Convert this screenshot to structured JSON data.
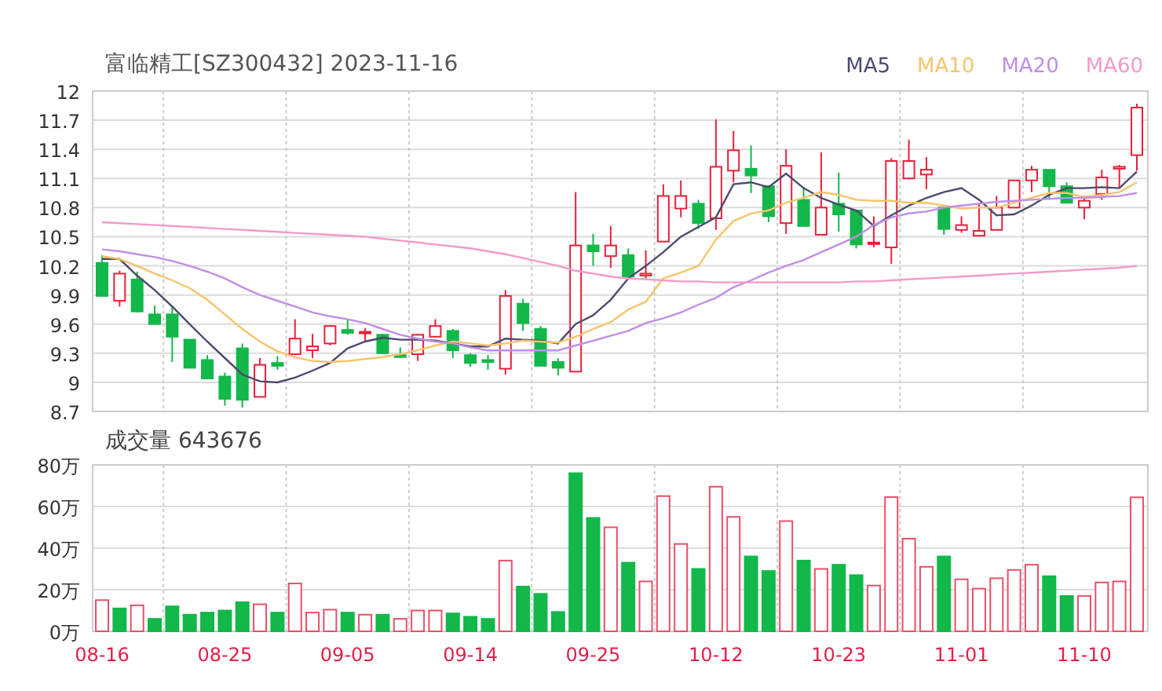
{
  "header": {
    "title": "富临精工[SZ300432] 2023-11-16"
  },
  "price_chart": {
    "chart_data": {
      "type": "candlestick",
      "grid": true,
      "ylim": [
        8.7,
        12
      ],
      "yticks": [
        12,
        11.7,
        11.4,
        11.1,
        10.8,
        10.5,
        10.2,
        9.9,
        9.6,
        9.3,
        9,
        8.7
      ],
      "categories": [
        null,
        null,
        null,
        null,
        null,
        null,
        null,
        null,
        null,
        null,
        null,
        null,
        null,
        null,
        null,
        null,
        null,
        null,
        null,
        null,
        null,
        null,
        null,
        null,
        null,
        null,
        null,
        null,
        null,
        null,
        null,
        null,
        null,
        null,
        null,
        null,
        null,
        null,
        null,
        null,
        null,
        null,
        null,
        null,
        null,
        null,
        null,
        null,
        null,
        null,
        null,
        null,
        null,
        null,
        null,
        null,
        null,
        null,
        null,
        null
      ],
      "ohlc": [
        [
          10.23,
          10.31,
          9.89,
          9.89
        ],
        [
          9.84,
          10.15,
          9.78,
          10.12
        ],
        [
          10.06,
          10.14,
          9.72,
          9.73
        ],
        [
          9.7,
          9.79,
          9.6,
          9.6
        ],
        [
          9.7,
          9.78,
          9.21,
          9.47
        ],
        [
          9.44,
          9.44,
          9.15,
          9.15
        ],
        [
          9.23,
          9.28,
          9.03,
          9.04
        ],
        [
          9.06,
          9.1,
          8.76,
          8.83
        ],
        [
          9.35,
          9.4,
          8.74,
          8.82
        ],
        [
          8.85,
          9.25,
          8.85,
          9.18
        ],
        [
          9.2,
          9.27,
          9.13,
          9.17
        ],
        [
          9.29,
          9.65,
          9.29,
          9.45
        ],
        [
          9.33,
          9.5,
          9.25,
          9.37
        ],
        [
          9.4,
          9.59,
          9.38,
          9.58
        ],
        [
          9.54,
          9.65,
          9.49,
          9.51
        ],
        [
          9.51,
          9.56,
          9.42,
          9.52
        ],
        [
          9.49,
          9.5,
          9.29,
          9.3
        ],
        [
          9.28,
          9.36,
          9.25,
          9.26
        ],
        [
          9.29,
          9.5,
          9.22,
          9.49
        ],
        [
          9.47,
          9.65,
          9.46,
          9.58
        ],
        [
          9.53,
          9.55,
          9.25,
          9.33
        ],
        [
          9.28,
          9.3,
          9.16,
          9.2
        ],
        [
          9.23,
          9.28,
          9.13,
          9.21
        ],
        [
          9.14,
          9.95,
          9.08,
          9.89
        ],
        [
          9.81,
          9.86,
          9.53,
          9.61
        ],
        [
          9.55,
          9.58,
          9.17,
          9.17
        ],
        [
          9.21,
          9.25,
          9.07,
          9.15
        ],
        [
          9.11,
          10.96,
          9.11,
          10.41
        ],
        [
          10.41,
          10.53,
          10.2,
          10.35
        ],
        [
          10.3,
          10.61,
          10.18,
          10.41
        ],
        [
          10.31,
          10.38,
          10.09,
          10.09
        ],
        [
          10.1,
          10.36,
          10.07,
          10.12
        ],
        [
          10.45,
          11.04,
          10.45,
          10.92
        ],
        [
          10.79,
          11.08,
          10.7,
          10.92
        ],
        [
          10.84,
          10.88,
          10.58,
          10.64
        ],
        [
          10.69,
          11.71,
          10.57,
          11.22
        ],
        [
          11.18,
          11.59,
          11.06,
          11.39
        ],
        [
          11.2,
          11.44,
          10.95,
          11.13
        ],
        [
          11.02,
          11.02,
          10.65,
          10.71
        ],
        [
          10.64,
          11.4,
          10.53,
          11.23
        ],
        [
          10.88,
          11.01,
          10.61,
          10.61
        ],
        [
          10.52,
          11.37,
          10.52,
          10.8
        ],
        [
          10.84,
          11.16,
          10.55,
          10.73
        ],
        [
          10.77,
          10.77,
          10.38,
          10.42
        ],
        [
          10.43,
          10.71,
          10.39,
          10.44
        ],
        [
          10.39,
          11.31,
          10.22,
          11.28
        ],
        [
          11.1,
          11.5,
          11.1,
          11.28
        ],
        [
          11.14,
          11.32,
          10.99,
          11.19
        ],
        [
          10.8,
          10.8,
          10.52,
          10.58
        ],
        [
          10.57,
          10.71,
          10.54,
          10.62
        ],
        [
          10.51,
          10.84,
          10.51,
          10.56
        ],
        [
          10.57,
          10.92,
          10.57,
          10.8
        ],
        [
          10.8,
          11.08,
          10.8,
          11.08
        ],
        [
          11.08,
          11.23,
          10.96,
          11.19
        ],
        [
          11.19,
          11.19,
          10.88,
          11.02
        ],
        [
          11.02,
          11.06,
          10.85,
          10.85
        ],
        [
          10.8,
          10.92,
          10.68,
          10.87
        ],
        [
          10.94,
          11.19,
          10.88,
          11.11
        ],
        [
          11.2,
          11.24,
          11.01,
          11.22
        ],
        [
          11.34,
          11.87,
          11.18,
          11.83
        ]
      ],
      "series": [
        {
          "name": "MA5",
          "type": "line",
          "color": "#4b4a6e",
          "values": [
            10.27,
            10.27,
            10.1,
            9.95,
            9.78,
            9.6,
            9.42,
            9.25,
            9.08,
            9.01,
            9.0,
            9.05,
            9.12,
            9.2,
            9.35,
            9.42,
            9.46,
            9.44,
            9.44,
            9.43,
            9.4,
            9.37,
            9.37,
            9.45,
            9.44,
            9.43,
            9.4,
            9.6,
            9.69,
            9.85,
            10.07,
            10.2,
            10.34,
            10.5,
            10.6,
            10.7,
            11.04,
            11.06,
            11.01,
            11.15,
            11.0,
            10.9,
            10.83,
            10.77,
            10.61,
            10.72,
            10.82,
            10.9,
            10.96,
            11.0,
            10.88,
            10.72,
            10.73,
            10.82,
            10.93,
            11.0,
            11.0,
            11.01,
            11.0,
            11.17
          ]
        },
        {
          "name": "MA10",
          "type": "line",
          "color": "#f7c46c",
          "values": [
            10.3,
            10.27,
            10.2,
            10.12,
            10.05,
            9.97,
            9.85,
            9.7,
            9.55,
            9.42,
            9.32,
            9.26,
            9.22,
            9.21,
            9.22,
            9.24,
            9.26,
            9.29,
            9.33,
            9.38,
            9.42,
            9.4,
            9.38,
            9.4,
            9.43,
            9.42,
            9.41,
            9.47,
            9.55,
            9.62,
            9.75,
            9.83,
            10.07,
            10.13,
            10.2,
            10.47,
            10.66,
            10.74,
            10.77,
            10.85,
            10.9,
            10.96,
            10.93,
            10.88,
            10.87,
            10.87,
            10.85,
            10.85,
            10.82,
            10.79,
            10.8,
            10.8,
            10.85,
            10.9,
            10.95,
            10.95,
            10.91,
            10.93,
            10.96,
            11.06
          ]
        },
        {
          "name": "MA20",
          "type": "line",
          "color": "#c08ee8",
          "values": [
            10.37,
            10.35,
            10.32,
            10.29,
            10.25,
            10.2,
            10.14,
            10.07,
            9.98,
            9.9,
            9.84,
            9.78,
            9.72,
            9.68,
            9.65,
            9.61,
            9.55,
            9.49,
            9.45,
            9.42,
            9.4,
            9.36,
            9.33,
            9.33,
            9.33,
            9.33,
            9.33,
            9.38,
            9.43,
            9.48,
            9.53,
            9.61,
            9.66,
            9.72,
            9.8,
            9.87,
            9.98,
            10.05,
            10.13,
            10.2,
            10.26,
            10.34,
            10.42,
            10.5,
            10.62,
            10.7,
            10.74,
            10.76,
            10.8,
            10.82,
            10.84,
            10.86,
            10.87,
            10.88,
            10.89,
            10.9,
            10.9,
            10.91,
            10.92,
            10.95
          ]
        },
        {
          "name": "MA60",
          "type": "line",
          "color": "#f59ac8",
          "values": [
            10.65,
            10.64,
            10.63,
            10.62,
            10.61,
            10.6,
            10.59,
            10.58,
            10.57,
            10.56,
            10.55,
            10.54,
            10.53,
            10.52,
            10.51,
            10.5,
            10.48,
            10.46,
            10.44,
            10.42,
            10.4,
            10.38,
            10.35,
            10.32,
            10.28,
            10.24,
            10.2,
            10.15,
            10.12,
            10.09,
            10.07,
            10.06,
            10.05,
            10.04,
            10.04,
            10.03,
            10.03,
            10.03,
            10.03,
            10.03,
            10.03,
            10.03,
            10.03,
            10.04,
            10.04,
            10.05,
            10.06,
            10.07,
            10.08,
            10.09,
            10.1,
            10.11,
            10.12,
            10.13,
            10.14,
            10.15,
            10.16,
            10.17,
            10.18,
            10.2
          ]
        }
      ]
    }
  },
  "volume_chart": {
    "title": "成交量 643676",
    "chart_data": {
      "type": "bar",
      "grid": true,
      "ylim": [
        0,
        80
      ],
      "categories": [
        "08-16",
        null,
        null,
        null,
        null,
        null,
        null,
        "08-25",
        null,
        null,
        null,
        null,
        null,
        null,
        "09-05",
        null,
        null,
        null,
        null,
        null,
        null,
        "09-14",
        null,
        null,
        null,
        null,
        null,
        null,
        "09-25",
        null,
        null,
        null,
        null,
        null,
        null,
        "10-12",
        null,
        null,
        null,
        null,
        null,
        null,
        "10-23",
        null,
        null,
        null,
        null,
        null,
        null,
        "11-01",
        null,
        null,
        null,
        null,
        null,
        null,
        "11-10",
        null,
        null,
        null
      ],
      "yticks": [
        {
          "value": 80,
          "label": "80万"
        },
        {
          "value": 60,
          "label": "60万"
        },
        {
          "value": 40,
          "label": "40万"
        },
        {
          "value": 20,
          "label": "20万"
        },
        {
          "value": 0,
          "label": "0万"
        }
      ],
      "series": [
        {
          "color": "#e8506a",
          "values": [
            15,
            null,
            12.5,
            null,
            null,
            null,
            null,
            null,
            null,
            13,
            null,
            23,
            9,
            10.4,
            null,
            8,
            null,
            6,
            10,
            10,
            null,
            null,
            null,
            34,
            null,
            null,
            null,
            null,
            null,
            50,
            null,
            24,
            65,
            42,
            null,
            69.5,
            55,
            null,
            null,
            53,
            null,
            30,
            null,
            null,
            22,
            64.5,
            44.5,
            31,
            null,
            25,
            20.5,
            25.5,
            29.5,
            32,
            null,
            null,
            17,
            23.5,
            24,
            64.4
          ]
        },
        {
          "color": "#12b84a",
          "values": [
            null,
            11,
            null,
            6,
            12,
            8,
            9,
            10,
            14,
            null,
            9,
            null,
            null,
            null,
            9,
            null,
            8,
            null,
            null,
            null,
            8.6,
            7,
            6,
            null,
            21.5,
            18,
            9.3,
            76,
            54.5,
            null,
            33,
            null,
            null,
            null,
            30,
            null,
            null,
            36,
            29,
            null,
            34,
            null,
            32,
            27,
            null,
            null,
            null,
            null,
            36,
            null,
            null,
            null,
            null,
            null,
            26.5,
            17,
            null,
            null,
            null,
            null
          ]
        }
      ]
    }
  }
}
